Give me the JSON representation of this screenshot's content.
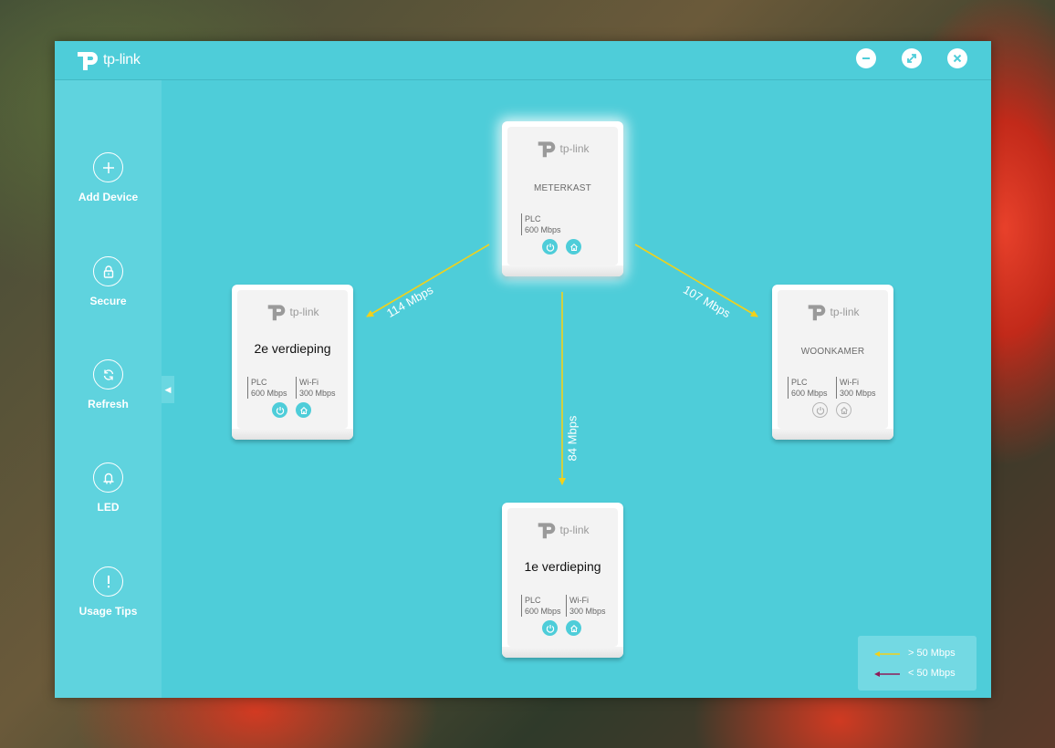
{
  "app": {
    "logo_text": "tp-link"
  },
  "window_controls": {
    "minimize_icon": "minus-circle-icon",
    "restore_icon": "restore-arrows-icon",
    "close_icon": "close-x-icon"
  },
  "sidebar": {
    "items": [
      {
        "label": "Add Device",
        "icon": "plus-icon"
      },
      {
        "label": "Secure",
        "icon": "lock-icon"
      },
      {
        "label": "Refresh",
        "icon": "refresh-icon"
      },
      {
        "label": "LED",
        "icon": "led-bulb-icon"
      },
      {
        "label": "Usage Tips",
        "icon": "exclamation-icon"
      }
    ],
    "collapse_icon": "triangle-left-icon"
  },
  "devices": {
    "meterkast": {
      "logo": "tp-link",
      "name": "METERKAST",
      "plc_label": "PLC",
      "plc_speed": "600 Mbps"
    },
    "tweede": {
      "logo": "tp-link",
      "name": "2e verdieping",
      "plc_label": "PLC",
      "plc_speed": "600 Mbps",
      "wifi_label": "Wi-Fi",
      "wifi_speed": "300 Mbps"
    },
    "woonkamer": {
      "logo": "tp-link",
      "name": "WOONKAMER",
      "plc_label": "PLC",
      "plc_speed": "600 Mbps",
      "wifi_label": "Wi-Fi",
      "wifi_speed": "300 Mbps"
    },
    "eerste": {
      "logo": "tp-link",
      "name": "1e verdieping",
      "plc_label": "PLC",
      "plc_speed": "600 Mbps",
      "wifi_label": "Wi-Fi",
      "wifi_speed": "300 Mbps"
    }
  },
  "links": {
    "to_tweede": "114 Mbps",
    "to_woonkamer": "107 Mbps",
    "to_eerste": "84 Mbps"
  },
  "legend": {
    "fast": {
      "label": "> 50 Mbps",
      "color": "#f2d11a"
    },
    "slow": {
      "label": "< 50 Mbps",
      "color": "#8e1c5a"
    }
  },
  "colors": {
    "accent": "#4ecdd9",
    "link_line": "#f2d11a"
  }
}
